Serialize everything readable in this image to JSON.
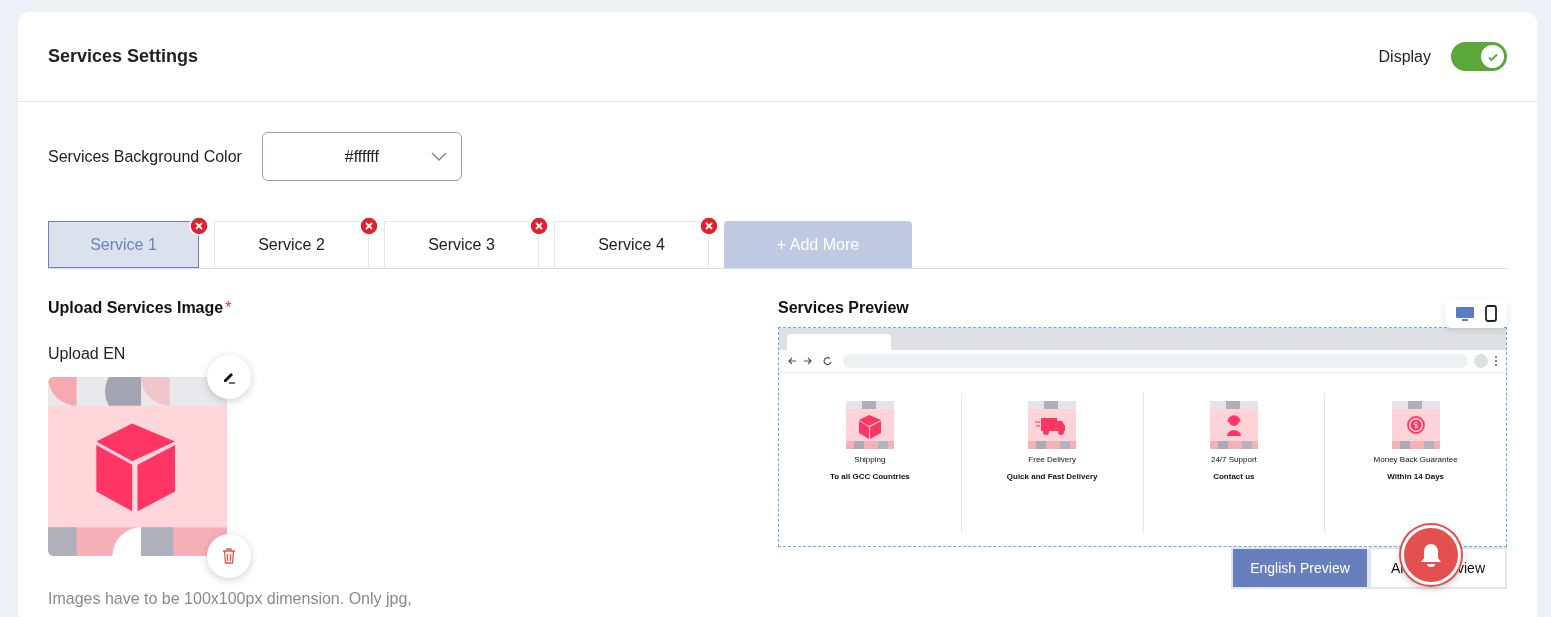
{
  "header": {
    "title": "Services Settings",
    "display_label": "Display",
    "display_on": true
  },
  "background_color": {
    "label": "Services Background Color",
    "value": "#ffffff"
  },
  "tabs": [
    {
      "label": "Service 1",
      "selected": true
    },
    {
      "label": "Service 2",
      "selected": false
    },
    {
      "label": "Service 3",
      "selected": false
    },
    {
      "label": "Service 4",
      "selected": false
    }
  ],
  "add_more": "+ Add More",
  "upload": {
    "title": "Upload Services Image",
    "required_mark": "*",
    "label": "Upload EN",
    "hint": "Images have to be 100x100px dimension. Only jpg,"
  },
  "preview": {
    "title": "Services Preview",
    "devices": [
      {
        "kind": "desktop",
        "selected": true
      },
      {
        "kind": "phone",
        "selected": false
      }
    ],
    "services": [
      {
        "kind": "box",
        "title": "Shipping",
        "subtitle": "To all GCC Countries"
      },
      {
        "kind": "truck",
        "title": "Free Delivery",
        "subtitle": "Quick and Fast Delivery"
      },
      {
        "kind": "support",
        "title": "24/7 Support",
        "subtitle": "Contact us"
      },
      {
        "kind": "money",
        "title": "Money Back Guarantee",
        "subtitle": "Within 14 Days"
      }
    ],
    "languages": [
      {
        "label_start": "English Preview",
        "selected": true
      },
      {
        "label_start": "Ar",
        "label_end": "view",
        "selected": false
      }
    ]
  }
}
